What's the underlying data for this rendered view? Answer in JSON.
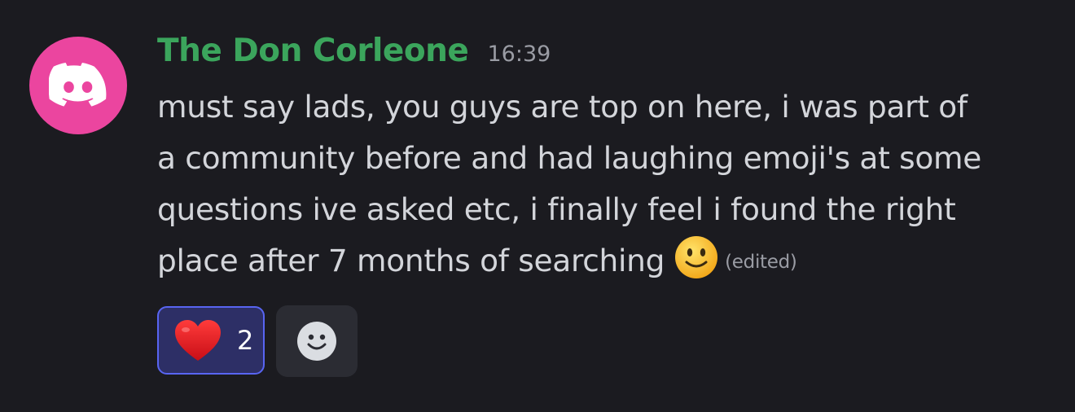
{
  "message": {
    "author": "The Don Corleone",
    "timestamp": "16:39",
    "lines": [
      "must say lads, you guys are top on here, i was part of",
      "a community before and had laughing emoji's at some",
      "questions ive asked etc, i finally feel i found the right",
      "place after 7 months of searching"
    ],
    "inline_emoji": "slightly-smiling-face",
    "edited_label": "(edited)",
    "avatar_color": "#eb459f",
    "author_color": "#3ba55c"
  },
  "reactions": [
    {
      "emoji": "red-heart",
      "count": "2",
      "active": true
    }
  ],
  "add_reaction": {
    "icon": "add-reaction-smiley-icon"
  }
}
